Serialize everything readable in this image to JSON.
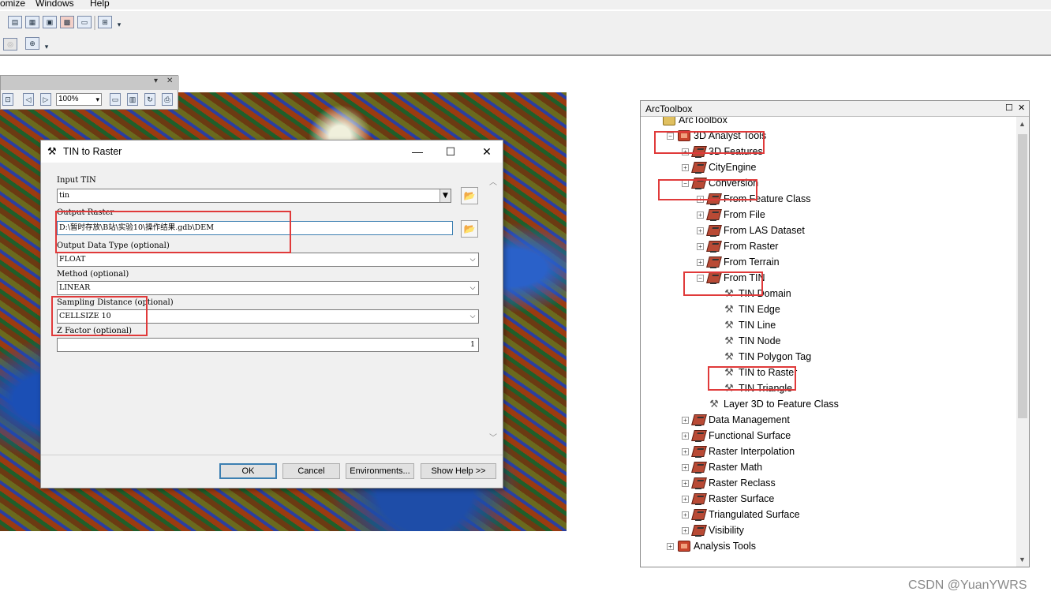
{
  "menu": {
    "items": [
      "omize",
      "Windows",
      "Help"
    ]
  },
  "map": {
    "zoom": "100%"
  },
  "dialog": {
    "title": "TIN to Raster",
    "controls": {
      "minimize": "—",
      "maximize": "☐",
      "close": "✕"
    },
    "params": {
      "input_tin": {
        "label": "Input TIN",
        "value": "tin"
      },
      "output_raster": {
        "label": "Output Raster",
        "value": "D:\\暂时存放\\B站\\实验10\\操作结果.gdb\\DEM"
      },
      "output_data_type": {
        "label": "Output Data Type (optional)",
        "value": "FLOAT"
      },
      "method": {
        "label": "Method (optional)",
        "value": "LINEAR"
      },
      "sampling_distance": {
        "label": "Sampling Distance (optional)",
        "value": "CELLSIZE 10"
      },
      "z_factor": {
        "label": "Z Factor (optional)",
        "value": "1"
      }
    },
    "buttons": {
      "ok": "OK",
      "cancel": "Cancel",
      "environments": "Environments...",
      "show_help": "Show Help >>"
    }
  },
  "toolbox": {
    "title": "ArcToolbox",
    "tree": [
      {
        "label": "ArcToolbox",
        "icon": "folder-icon",
        "expander": ""
      },
      {
        "label": "3D Analyst Tools",
        "icon": "toolbox-icon",
        "expander": "−"
      },
      {
        "label": "3D Features",
        "icon": "toolset-icon",
        "expander": "+"
      },
      {
        "label": "CityEngine",
        "icon": "toolset-icon",
        "expander": "+"
      },
      {
        "label": "Conversion",
        "icon": "toolset-icon",
        "expander": "−"
      },
      {
        "label": "From Feature Class",
        "icon": "toolset-icon",
        "expander": "+"
      },
      {
        "label": "From File",
        "icon": "toolset-icon",
        "expander": "+"
      },
      {
        "label": "From LAS Dataset",
        "icon": "toolset-icon",
        "expander": "+"
      },
      {
        "label": "From Raster",
        "icon": "toolset-icon",
        "expander": "+"
      },
      {
        "label": "From Terrain",
        "icon": "toolset-icon",
        "expander": "+"
      },
      {
        "label": "From TIN",
        "icon": "toolset-icon",
        "expander": "−"
      },
      {
        "label": "TIN Domain",
        "icon": "hammer-icon",
        "expander": ""
      },
      {
        "label": "TIN Edge",
        "icon": "hammer-icon",
        "expander": ""
      },
      {
        "label": "TIN Line",
        "icon": "hammer-icon",
        "expander": ""
      },
      {
        "label": "TIN Node",
        "icon": "hammer-icon",
        "expander": ""
      },
      {
        "label": "TIN Polygon Tag",
        "icon": "hammer-icon",
        "expander": ""
      },
      {
        "label": "TIN to Raster",
        "icon": "hammer-icon",
        "expander": ""
      },
      {
        "label": "TIN Triangle",
        "icon": "hammer-icon",
        "expander": ""
      },
      {
        "label": "Layer 3D to Feature Class",
        "icon": "hammer-icon",
        "expander": ""
      },
      {
        "label": "Data Management",
        "icon": "toolset-icon",
        "expander": "+"
      },
      {
        "label": "Functional Surface",
        "icon": "toolset-icon",
        "expander": "+"
      },
      {
        "label": "Raster Interpolation",
        "icon": "toolset-icon",
        "expander": "+"
      },
      {
        "label": "Raster Math",
        "icon": "toolset-icon",
        "expander": "+"
      },
      {
        "label": "Raster Reclass",
        "icon": "toolset-icon",
        "expander": "+"
      },
      {
        "label": "Raster Surface",
        "icon": "toolset-icon",
        "expander": "+"
      },
      {
        "label": "Triangulated Surface",
        "icon": "toolset-icon",
        "expander": "+"
      },
      {
        "label": "Visibility",
        "icon": "toolset-icon",
        "expander": "+"
      },
      {
        "label": "Analysis Tools",
        "icon": "toolbox-icon",
        "expander": "+"
      }
    ]
  },
  "watermark": "CSDN @YuanYWRS",
  "colors": {
    "annotation": "#e03a3a",
    "accent": "#3c7fb1"
  }
}
